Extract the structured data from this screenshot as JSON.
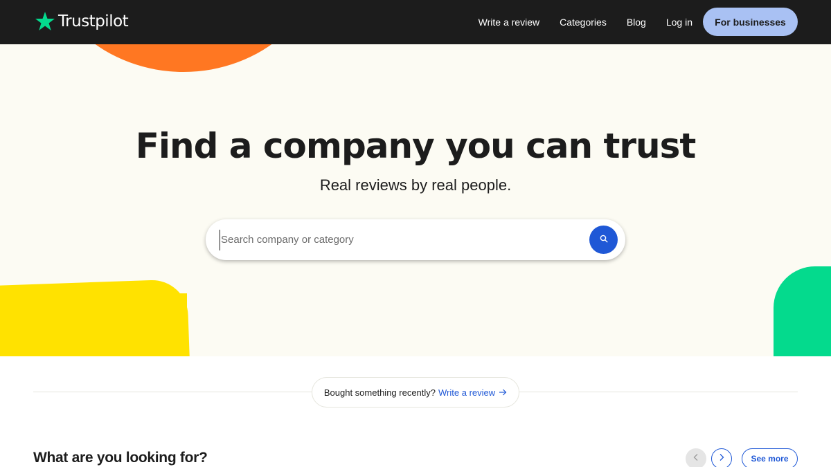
{
  "header": {
    "logo_text": "Trustpilot",
    "nav": [
      {
        "label": "Write a review"
      },
      {
        "label": "Categories"
      },
      {
        "label": "Blog"
      },
      {
        "label": "Log in"
      }
    ],
    "business_button": "For businesses"
  },
  "hero": {
    "title": "Find a company you can trust",
    "subtitle": "Real reviews by real people.",
    "search_placeholder": "Search company or category"
  },
  "prompt": {
    "text": "Bought something recently?",
    "link": "Write a review"
  },
  "section": {
    "title": "What are you looking for?",
    "see_more": "See more"
  },
  "colors": {
    "accent_blue": "#1f58d6",
    "trust_green": "#04da8d",
    "orange": "#ff7722",
    "yellow": "#ffe200",
    "header_bg": "#1c1c1c"
  },
  "icons": [
    "star-icon",
    "search-icon",
    "arrow-right-icon",
    "chevron-left-icon",
    "chevron-right-icon"
  ]
}
